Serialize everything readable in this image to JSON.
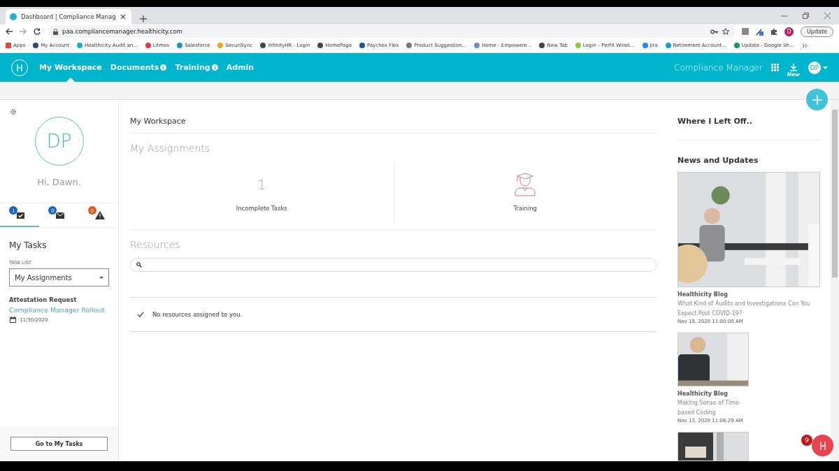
{
  "browser": {
    "tab_title": "Dashboard | Compliance Manag",
    "url": "paa.compliancemanager.healthicity.com",
    "update_button": "Update",
    "avatar": "D",
    "bookmarks": [
      {
        "label": "Apps",
        "color": "#e8453c"
      },
      {
        "label": "My Account",
        "color": "#2d4a6b"
      },
      {
        "label": "Healthicity Audit an...",
        "color": "#17b3c8"
      },
      {
        "label": "Litmos",
        "color": "#e03a4e"
      },
      {
        "label": "Salesforce",
        "color": "#1798c1"
      },
      {
        "label": "SecuriSync",
        "color": "#f2a71b"
      },
      {
        "label": "InfinityHR - Login",
        "color": "#3c4a52"
      },
      {
        "label": "HomePage",
        "color": "#3c4a52"
      },
      {
        "label": "Paychex Flex",
        "color": "#1f4ea0"
      },
      {
        "label": "Product Suggestion...",
        "color": "#777777"
      },
      {
        "label": "Home - Empowere...",
        "color": "#6d8fc9"
      },
      {
        "label": "New Tab",
        "color": "#444444"
      },
      {
        "label": "Login – PerfX Wireli...",
        "color": "#8cc63f"
      },
      {
        "label": "Jira",
        "color": "#2684ff"
      },
      {
        "label": "Retirement Account...",
        "color": "#1aa0c8"
      },
      {
        "label": "Update - Google Sh...",
        "color": "#0f9d58"
      }
    ]
  },
  "app_nav": {
    "items": [
      {
        "label": "My Workspace",
        "selected": true,
        "info": false
      },
      {
        "label": "Documents",
        "selected": false,
        "info": true
      },
      {
        "label": "Training",
        "selected": false,
        "info": true
      },
      {
        "label": "Admin",
        "selected": false,
        "info": false
      }
    ],
    "brand": "Compliance Manager",
    "download_label": "New",
    "avatar": "DP"
  },
  "sidebar": {
    "initials": "DP",
    "greeting": "Hi, Dawn.",
    "tabs": [
      {
        "kind": "tasks",
        "badge": "1",
        "color": "#1565c0",
        "selected": true
      },
      {
        "kind": "messages",
        "badge": "0",
        "color": "#1565c0",
        "selected": false
      },
      {
        "kind": "alerts",
        "badge": "0",
        "color": "#e0561b",
        "selected": false
      }
    ],
    "title": "My Tasks",
    "task_list_label": "TASK LIST",
    "task_list_value": "My Assignments",
    "task": {
      "type": "Attestation Request",
      "title": "Compliance Manager Rollout",
      "date": "11/30/2020"
    },
    "button": "Go to My Tasks"
  },
  "main": {
    "title": "My Workspace",
    "assignments_heading": "My Assignments",
    "stats": [
      {
        "kind": "count",
        "value": "1",
        "label": "Incomplete Tasks"
      },
      {
        "kind": "training",
        "label": "Training"
      }
    ],
    "resources_heading": "Resources",
    "empty_message": "No resources assigned to you."
  },
  "right": {
    "where_left_off": "Where I Left Off..",
    "news_heading": "News and Updates",
    "articles": [
      {
        "kind": "featured",
        "source": "Healthicity Blog",
        "title": "What Kind of Audits and Investigations Can You Expect Post COVID-19?",
        "date": "Nov 19, 2020 11:00:00 AM"
      },
      {
        "kind": "standard",
        "source": "Healthicity Blog",
        "title": "Making Sense of Time-based Coding",
        "date": "Nov 13, 2020 11:06:29 AM"
      },
      {
        "kind": "partial"
      }
    ]
  },
  "chat_badge": "9"
}
